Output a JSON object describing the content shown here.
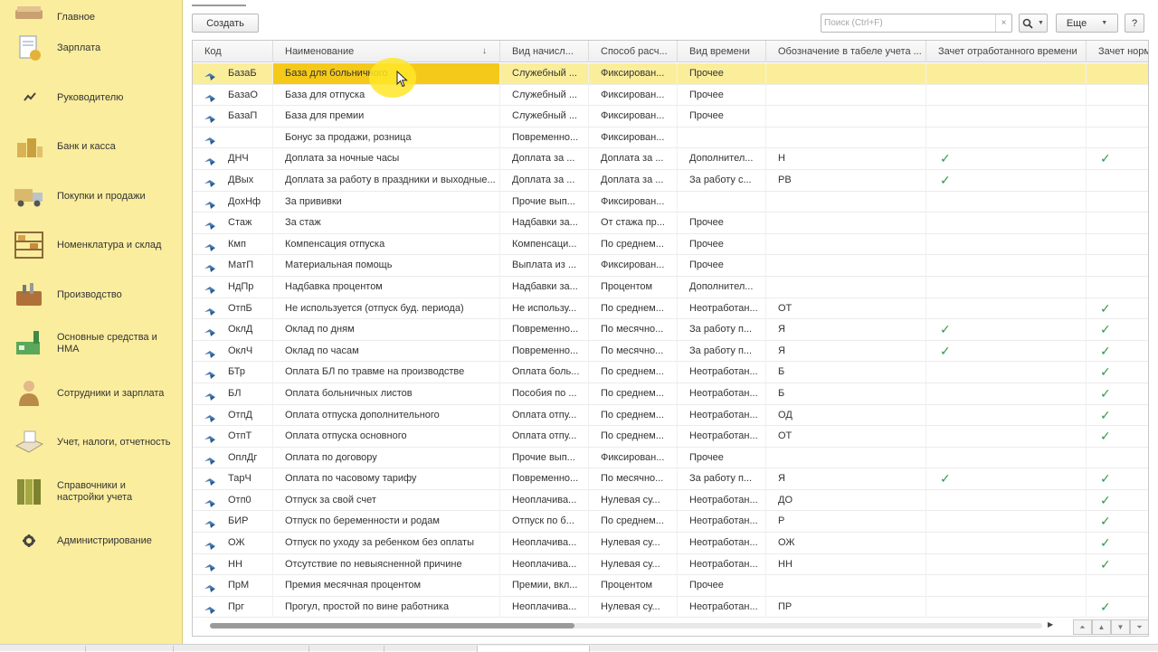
{
  "sidebar": {
    "items": [
      {
        "label": "Главное",
        "icon": "home-icon"
      },
      {
        "label": "Зарплата",
        "icon": "salary-icon"
      },
      {
        "label": "Руководителю",
        "icon": "chart-trend-icon"
      },
      {
        "label": "Банк и касса",
        "icon": "coins-icon"
      },
      {
        "label": "Покупки и продажи",
        "icon": "truck-icon"
      },
      {
        "label": "Номенклатура и склад",
        "icon": "warehouse-shelf-icon"
      },
      {
        "label": "Производство",
        "icon": "toolbox-icon"
      },
      {
        "label": "Основные средства и НМА",
        "icon": "factory-icon"
      },
      {
        "label": "Сотрудники и зарплата",
        "icon": "employee-icon"
      },
      {
        "label": "Учет, налоги, отчетность",
        "icon": "report-icon"
      },
      {
        "label": "Справочники и настройки учета",
        "icon": "binders-icon"
      },
      {
        "label": "Администрирование",
        "icon": "gear-icon"
      }
    ]
  },
  "toolbar": {
    "create_label": "Создать",
    "search_placeholder": "Поиск (Ctrl+F)",
    "search_clear": "×",
    "find_icon": "search-icon",
    "more_label": "Еще",
    "help_label": "?"
  },
  "table": {
    "columns": [
      "Код",
      "Наименование",
      "Вид начисл...",
      "Способ расч...",
      "Вид времени",
      "Обозначение в табеле учета ...",
      "Зачет отработанного времени",
      "Зачет норм"
    ],
    "sort_indicator": "↓",
    "check_mark": "✓",
    "rows": [
      {
        "code": "БазаБ",
        "name": "База для больничного",
        "kind": "Служебный ...",
        "method": "Фиксирован...",
        "time": "Прочее",
        "mark": "",
        "worked": false,
        "norm": false,
        "selected": true
      },
      {
        "code": "БазаО",
        "name": "База для отпуска",
        "kind": "Служебный ...",
        "method": "Фиксирован...",
        "time": "Прочее",
        "mark": "",
        "worked": false,
        "norm": false
      },
      {
        "code": "БазаП",
        "name": "База для премии",
        "kind": "Служебный ...",
        "method": "Фиксирован...",
        "time": "Прочее",
        "mark": "",
        "worked": false,
        "norm": false
      },
      {
        "code": "",
        "name": "Бонус за продажи, розница",
        "kind": "Повременно...",
        "method": "Фиксирован...",
        "time": "",
        "mark": "",
        "worked": false,
        "norm": false
      },
      {
        "code": "ДНЧ",
        "name": "Доплата за ночные часы",
        "kind": "Доплата за ...",
        "method": "Доплата за ...",
        "time": "Дополнител...",
        "mark": "Н",
        "worked": true,
        "norm": true
      },
      {
        "code": "ДВых",
        "name": "Доплата за работу в праздники и выходные...",
        "kind": "Доплата за ...",
        "method": "Доплата за ...",
        "time": "За работу с...",
        "mark": "РВ",
        "worked": true,
        "norm": false
      },
      {
        "code": "ДохНф",
        "name": "За прививки",
        "kind": "Прочие вып...",
        "method": "Фиксирован...",
        "time": "",
        "mark": "",
        "worked": false,
        "norm": false
      },
      {
        "code": "Стаж",
        "name": "За стаж",
        "kind": "Надбавки за...",
        "method": "От стажа пр...",
        "time": "Прочее",
        "mark": "",
        "worked": false,
        "norm": false
      },
      {
        "code": "Кмп",
        "name": "Компенсация отпуска",
        "kind": "Компенсаци...",
        "method": "По среднем...",
        "time": "Прочее",
        "mark": "",
        "worked": false,
        "norm": false
      },
      {
        "code": "МатП",
        "name": "Материальная помощь",
        "kind": "Выплата из ...",
        "method": "Фиксирован...",
        "time": "Прочее",
        "mark": "",
        "worked": false,
        "norm": false
      },
      {
        "code": "НдПр",
        "name": "Надбавка процентом",
        "kind": "Надбавки за...",
        "method": "Процентом",
        "time": "Дополнител...",
        "mark": "",
        "worked": false,
        "norm": false
      },
      {
        "code": "ОтпБ",
        "name": "Не используется (отпуск буд. периода)",
        "kind": "Не использу...",
        "method": "По среднем...",
        "time": "Неотработан...",
        "mark": "ОТ",
        "worked": false,
        "norm": true
      },
      {
        "code": "ОклД",
        "name": "Оклад по дням",
        "kind": "Повременно...",
        "method": "По месячно...",
        "time": "За работу п...",
        "mark": "Я",
        "worked": true,
        "norm": true
      },
      {
        "code": "ОклЧ",
        "name": "Оклад по часам",
        "kind": "Повременно...",
        "method": "По месячно...",
        "time": "За работу п...",
        "mark": "Я",
        "worked": true,
        "norm": true
      },
      {
        "code": "БТр",
        "name": "Оплата БЛ по травме на производстве",
        "kind": "Оплата боль...",
        "method": "По среднем...",
        "time": "Неотработан...",
        "mark": "Б",
        "worked": false,
        "norm": true
      },
      {
        "code": "БЛ",
        "name": "Оплата больничных листов",
        "kind": "Пособия по ...",
        "method": "По среднем...",
        "time": "Неотработан...",
        "mark": "Б",
        "worked": false,
        "norm": true
      },
      {
        "code": "ОтпД",
        "name": "Оплата отпуска дополнительного",
        "kind": "Оплата отпу...",
        "method": "По среднем...",
        "time": "Неотработан...",
        "mark": "ОД",
        "worked": false,
        "norm": true
      },
      {
        "code": "ОтпТ",
        "name": "Оплата отпуска основного",
        "kind": "Оплата отпу...",
        "method": "По среднем...",
        "time": "Неотработан...",
        "mark": "ОТ",
        "worked": false,
        "norm": true
      },
      {
        "code": "ОплДг",
        "name": "Оплата по договору",
        "kind": "Прочие вып...",
        "method": "Фиксирован...",
        "time": "Прочее",
        "mark": "",
        "worked": false,
        "norm": false
      },
      {
        "code": "ТарЧ",
        "name": "Оплата по часовому тарифу",
        "kind": "Повременно...",
        "method": "По месячно...",
        "time": "За работу п...",
        "mark": "Я",
        "worked": true,
        "norm": true
      },
      {
        "code": "Отп0",
        "name": "Отпуск за свой счет",
        "kind": "Неоплачива...",
        "method": "Нулевая су...",
        "time": "Неотработан...",
        "mark": "ДО",
        "worked": false,
        "norm": true
      },
      {
        "code": "БИР",
        "name": "Отпуск по беременности и родам",
        "kind": "Отпуск по б...",
        "method": "По среднем...",
        "time": "Неотработан...",
        "mark": "Р",
        "worked": false,
        "norm": true
      },
      {
        "code": "ОЖ",
        "name": "Отпуск по уходу за ребенком без оплаты",
        "kind": "Неоплачива...",
        "method": "Нулевая су...",
        "time": "Неотработан...",
        "mark": "ОЖ",
        "worked": false,
        "norm": true
      },
      {
        "code": "НН",
        "name": "Отсутствие по невыясненной причине",
        "kind": "Неоплачива...",
        "method": "Нулевая су...",
        "time": "Неотработан...",
        "mark": "НН",
        "worked": false,
        "norm": true
      },
      {
        "code": "ПрМ",
        "name": "Премия месячная процентом",
        "kind": "Премии, вкл...",
        "method": "Процентом",
        "time": "Прочее",
        "mark": "",
        "worked": false,
        "norm": false
      },
      {
        "code": "Прг",
        "name": "Прогул, простой по вине работника",
        "kind": "Неоплачива...",
        "method": "Нулевая су...",
        "time": "Неотработан...",
        "mark": "ПР",
        "worked": false,
        "norm": true
      }
    ]
  },
  "colors": {
    "sidebar_bg": "#fbed9e",
    "selected_row": "#fbee9b",
    "selected_cell": "#f5c91a",
    "check_green": "#2f9a48"
  }
}
